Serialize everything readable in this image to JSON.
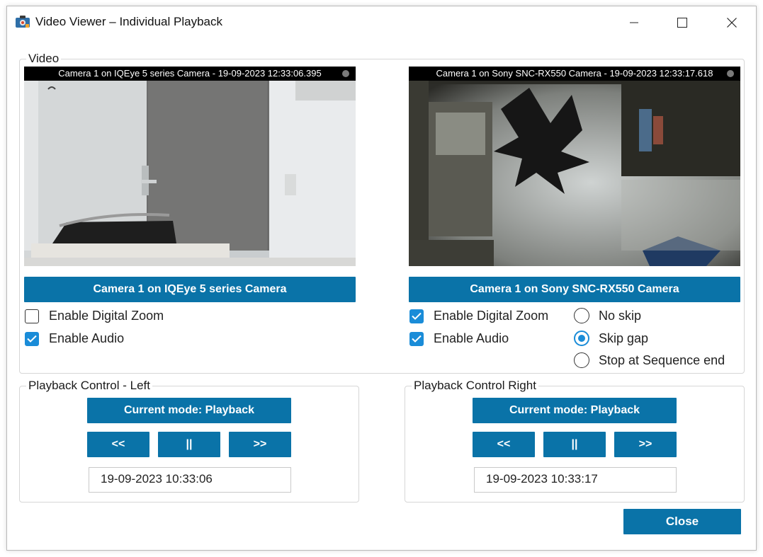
{
  "window": {
    "title": "Video Viewer – Individual Playback"
  },
  "video_group": {
    "label": "Video",
    "left": {
      "overlay": "Camera 1 on IQEye 5 series Camera - 19-09-2023 12:33:06.395",
      "camera_button": "Camera 1 on IQEye 5 series Camera",
      "enable_digital_zoom": {
        "label": "Enable Digital Zoom",
        "checked": false
      },
      "enable_audio": {
        "label": "Enable Audio",
        "checked": true
      }
    },
    "right": {
      "overlay": "Camera 1 on Sony SNC-RX550 Camera - 19-09-2023 12:33:17.618",
      "camera_button": "Camera 1 on Sony SNC-RX550 Camera",
      "enable_digital_zoom": {
        "label": "Enable Digital Zoom",
        "checked": true
      },
      "enable_audio": {
        "label": "Enable Audio",
        "checked": true
      },
      "skip_options": [
        {
          "label": "No skip",
          "selected": false
        },
        {
          "label": "Skip gap",
          "selected": true
        },
        {
          "label": "Stop at Sequence end",
          "selected": false
        }
      ]
    }
  },
  "playback_left": {
    "label": "Playback Control - Left",
    "mode_button": "Current mode: Playback",
    "rewind": "<<",
    "pause": "||",
    "forward": ">>",
    "datetime": "19-09-2023  10:33:06"
  },
  "playback_right": {
    "label": "Playback Control Right",
    "mode_button": "Current mode: Playback",
    "rewind": "<<",
    "pause": "||",
    "forward": ">>",
    "datetime": "19-09-2023  10:33:17"
  },
  "footer": {
    "close_button": "Close"
  },
  "colors": {
    "accent": "#0a73a8",
    "check": "#1a8cd8"
  }
}
